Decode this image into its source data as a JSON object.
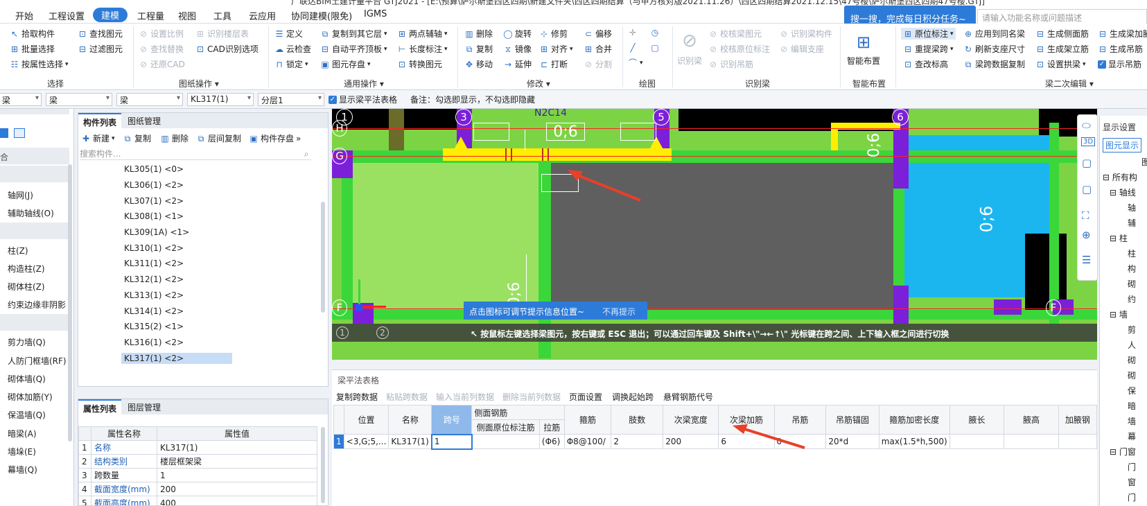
{
  "title": "广联达BIM土建计量平台 GTJ2021 - [E:\\预算\\萨尔斯堡西区四期\\新建文件夹\\西区四期结算（与甲方核对版2021.11.26）\\西区四期结算2021.12.15\\47号楼\\萨尔斯堡西区四期47号楼.GTJ]",
  "menu": [
    "开始",
    "工程设置",
    "建模",
    "工程量",
    "视图",
    "工具",
    "云应用",
    "协同建模(限免)",
    "IGMS"
  ],
  "active_menu": "建模",
  "search_banner": "搜一搜，完成每日积分任务~",
  "search_placeholder": "请输入功能名称或问题描述",
  "ribbon": {
    "select": {
      "items": [
        "拾取构件",
        "批量选择",
        "按属性选择",
        "查找图元",
        "过滤图元"
      ],
      "label": "选择"
    },
    "drawing_ops": {
      "items": [
        "设置比例",
        "查找替换",
        "还原CAD",
        "识别楼层表",
        "CAD识别选项"
      ],
      "label": "图纸操作"
    },
    "common": {
      "items": [
        "定义",
        "云检查",
        "锁定",
        "复制到其它层",
        "自动平齐顶板",
        "图元存盘",
        "两点辅轴",
        "长度标注",
        "转换图元"
      ],
      "label": "通用操作"
    },
    "modify": {
      "items": [
        "删除",
        "复制",
        "移动",
        "旋转",
        "镜像",
        "延伸",
        "修剪",
        "对齐",
        "打断",
        "偏移",
        "合并",
        "分割"
      ],
      "label": "修改"
    },
    "draw": {
      "label": "绘图"
    },
    "identify": {
      "items": [
        "识别梁",
        "校核梁图元",
        "校核原位标注",
        "识别吊筋",
        "识别梁构件",
        "编辑支座"
      ],
      "label": "识别梁"
    },
    "smart": {
      "items": [
        "智能布置"
      ],
      "label": "智能布置"
    },
    "secondary": {
      "items": [
        "原位标注",
        "重提梁跨",
        "查改标高",
        "应用到同名梁",
        "刷新支座尺寸",
        "梁跨数据复制",
        "生成侧面筋",
        "生成架立筋",
        "设置拱梁",
        "生成梁加腋",
        "生成吊筋",
        "显示吊筋"
      ],
      "label": "梁二次编辑"
    }
  },
  "filterbar": {
    "dd1": "梁",
    "dd2": "梁",
    "dd3": "KL317(1)",
    "dd4": "分层1",
    "checkbox": "显示梁平法表格",
    "note": "备注：勾选即显示，不勾选即隐藏"
  },
  "leftnav": [
    "轴网(J)",
    "辅助轴线(O)",
    "柱(Z)",
    "构造柱(Z)",
    "砌体柱(Z)",
    "约束边缘非阴影",
    "剪力墙(Q)",
    "人防门框墙(RF)",
    "砌体墙(Q)",
    "砌体加筋(Y)",
    "保温墙(Q)",
    "暗梁(A)",
    "墙垛(E)",
    "幕墙(Q)"
  ],
  "complist": {
    "tabs": [
      "构件列表",
      "图纸管理"
    ],
    "toolbar": [
      "新建",
      "复制",
      "删除",
      "层间复制",
      "构件存盘"
    ],
    "search_placeholder": "搜索构件...",
    "items": [
      "KL305(1) <0>",
      "KL306(1) <2>",
      "KL307(1) <2>",
      "KL308(1) <1>",
      "KL309(1A) <1>",
      "KL310(1) <2>",
      "KL311(1) <2>",
      "KL312(1) <2>",
      "KL313(1) <2>",
      "KL314(1) <2>",
      "KL315(2) <1>",
      "KL316(1) <2>",
      "KL317(1) <2>"
    ],
    "selected": "KL317(1) <2>"
  },
  "props": {
    "tabs": [
      "属性列表",
      "图层管理"
    ],
    "headers": [
      "属性名称",
      "属性值"
    ],
    "rows": [
      {
        "n": "1",
        "name": "名称",
        "value": "KL317(1)"
      },
      {
        "n": "2",
        "name": "结构类别",
        "value": "楼层框架梁"
      },
      {
        "n": "3",
        "name": "跨数量",
        "value": "1"
      },
      {
        "n": "4",
        "name": "截面宽度(mm)",
        "value": "200"
      },
      {
        "n": "5",
        "name": "截面高度(mm)",
        "value": "400"
      }
    ]
  },
  "canvas": {
    "axis_top": [
      "1",
      "3",
      "5",
      "6"
    ],
    "axis_left": [
      "H",
      "G",
      "F"
    ],
    "axis_bottom": [
      "1",
      "2"
    ],
    "beam_labels": [
      "0;6",
      "0;6",
      "0;6",
      "0;6"
    ],
    "top_text": "N2C14",
    "tip": "点击图标可调节提示信息位置~",
    "tip_dismiss": "不再提示",
    "status": "按鼠标左键选择梁图元，按右键或 ESC 退出；可以通过回车键及 Shift+\\\"→←↑\\\" 光标键在跨之间、上下输入框之间进行切换"
  },
  "beamtable": {
    "title": "梁平法表格",
    "toolbar": [
      "复制跨数据",
      "粘贴跨数据",
      "输入当前列数据",
      "删除当前列数据",
      "页面设置",
      "调换起始跨",
      "悬臂钢筋代号"
    ],
    "group_header": "侧面钢筋",
    "headers": [
      "位置",
      "名称",
      "跨号",
      "侧面原位标注筋",
      "拉筋",
      "箍筋",
      "肢数",
      "次梁宽度",
      "次梁加筋",
      "吊筋",
      "吊筋锚固",
      "箍筋加密长度",
      "腋长",
      "腋高",
      "加腋钢"
    ],
    "row": {
      "idx": "1",
      "pos": "<3,G;5,...",
      "name": "KL317(1)",
      "span": "1",
      "side": "",
      "tie": "(Φ6)",
      "stirrup": "Φ8@100/",
      "legs": "2",
      "subw": "200",
      "subadd": "6",
      "hanger": "0",
      "anchor": "20*d",
      "dense": "max(1.5*h,500)",
      "yl": "",
      "yh": "",
      "yj": ""
    }
  },
  "rightpanel": {
    "title": "显示设置",
    "tab": "图元显示",
    "items": [
      "图",
      "所有构",
      "轴线",
      "轴",
      "辅",
      "柱",
      "柱",
      "构",
      "砌",
      "约",
      "墙",
      "剪",
      "人",
      "砌",
      "砌",
      "保",
      "暗",
      "墙",
      "幕",
      "门窗",
      "门",
      "窗",
      "门"
    ]
  },
  "colors": {
    "accent": "#2d7bd8",
    "beam_green": "#38d336",
    "slab_light": "#8fd65a",
    "slab_dark": "#5a5a5a",
    "column": "#7b1fd9",
    "cyan": "#1bb6ef",
    "highlight": "#ffee00",
    "arrow": "#e8402a"
  }
}
